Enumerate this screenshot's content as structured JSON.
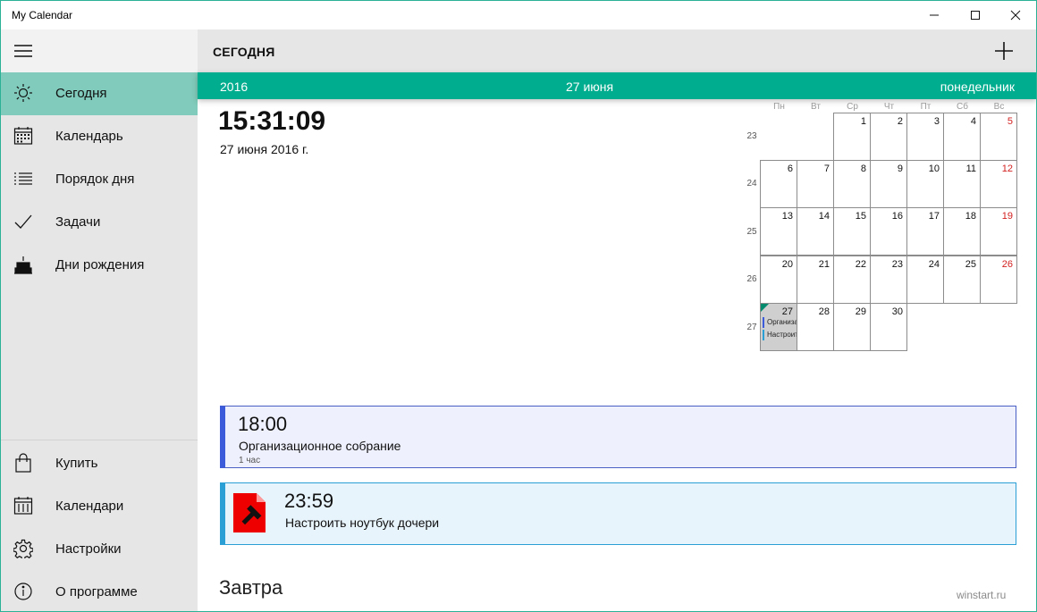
{
  "window": {
    "title": "My Calendar"
  },
  "header": {
    "title": "СЕГОДНЯ"
  },
  "datebar": {
    "year": "2016",
    "date": "27 июня",
    "weekday": "понедельник"
  },
  "clock": {
    "time": "15:31:09",
    "date": "27 июня 2016 г."
  },
  "sidebar": {
    "items": [
      {
        "label": "Сегодня",
        "icon": "sun-icon",
        "active": true
      },
      {
        "label": "Календарь",
        "icon": "calendar-icon"
      },
      {
        "label": "Порядок дня",
        "icon": "list-icon"
      },
      {
        "label": "Задачи",
        "icon": "checkmark-icon"
      },
      {
        "label": "Дни рождения",
        "icon": "birthday-cake-icon"
      }
    ],
    "bottom_items": [
      {
        "label": "Купить",
        "icon": "shopping-bag-icon"
      },
      {
        "label": "Календари",
        "icon": "calendars-icon"
      },
      {
        "label": "Настройки",
        "icon": "gear-icon"
      },
      {
        "label": "О программе",
        "icon": "info-icon"
      }
    ]
  },
  "mini_calendar": {
    "weekdays": [
      "Пн",
      "Вт",
      "Ср",
      "Чт",
      "Пт",
      "Сб",
      "Вс"
    ],
    "weeks": [
      {
        "number": "23",
        "days": [
          "",
          "",
          "1",
          "2",
          "3",
          "4",
          "5"
        ]
      },
      {
        "number": "24",
        "days": [
          "6",
          "7",
          "8",
          "9",
          "10",
          "11",
          "12"
        ]
      },
      {
        "number": "25",
        "days": [
          "13",
          "14",
          "15",
          "16",
          "17",
          "18",
          "19"
        ]
      },
      {
        "number": "26",
        "days": [
          "20",
          "21",
          "22",
          "23",
          "24",
          "25",
          "26"
        ]
      },
      {
        "number": "27",
        "days": [
          "27",
          "28",
          "29",
          "30",
          "",
          "",
          ""
        ]
      }
    ],
    "today": "27",
    "today_events": [
      "Организационное собрание",
      "Настроить ноутбук дочери"
    ],
    "colors": {
      "weekend": "#d32020",
      "today_bg": "#cfcfcf"
    }
  },
  "events": [
    {
      "time": "18:00",
      "title": "Организационное собрание",
      "duration": "1 час",
      "color": "#3b5bdb"
    },
    {
      "time": "23:59",
      "title": "Настроить ноутбук дочери",
      "icon": "task-document-icon",
      "color": "#2a9fd6"
    }
  ],
  "tomorrow": {
    "heading": "Завтра"
  },
  "watermark": "winstart.ru",
  "colors": {
    "accent": "#00ad8e",
    "sidebar_active": "#80cbbb",
    "sidebar_bg": "#e6e6e6"
  }
}
